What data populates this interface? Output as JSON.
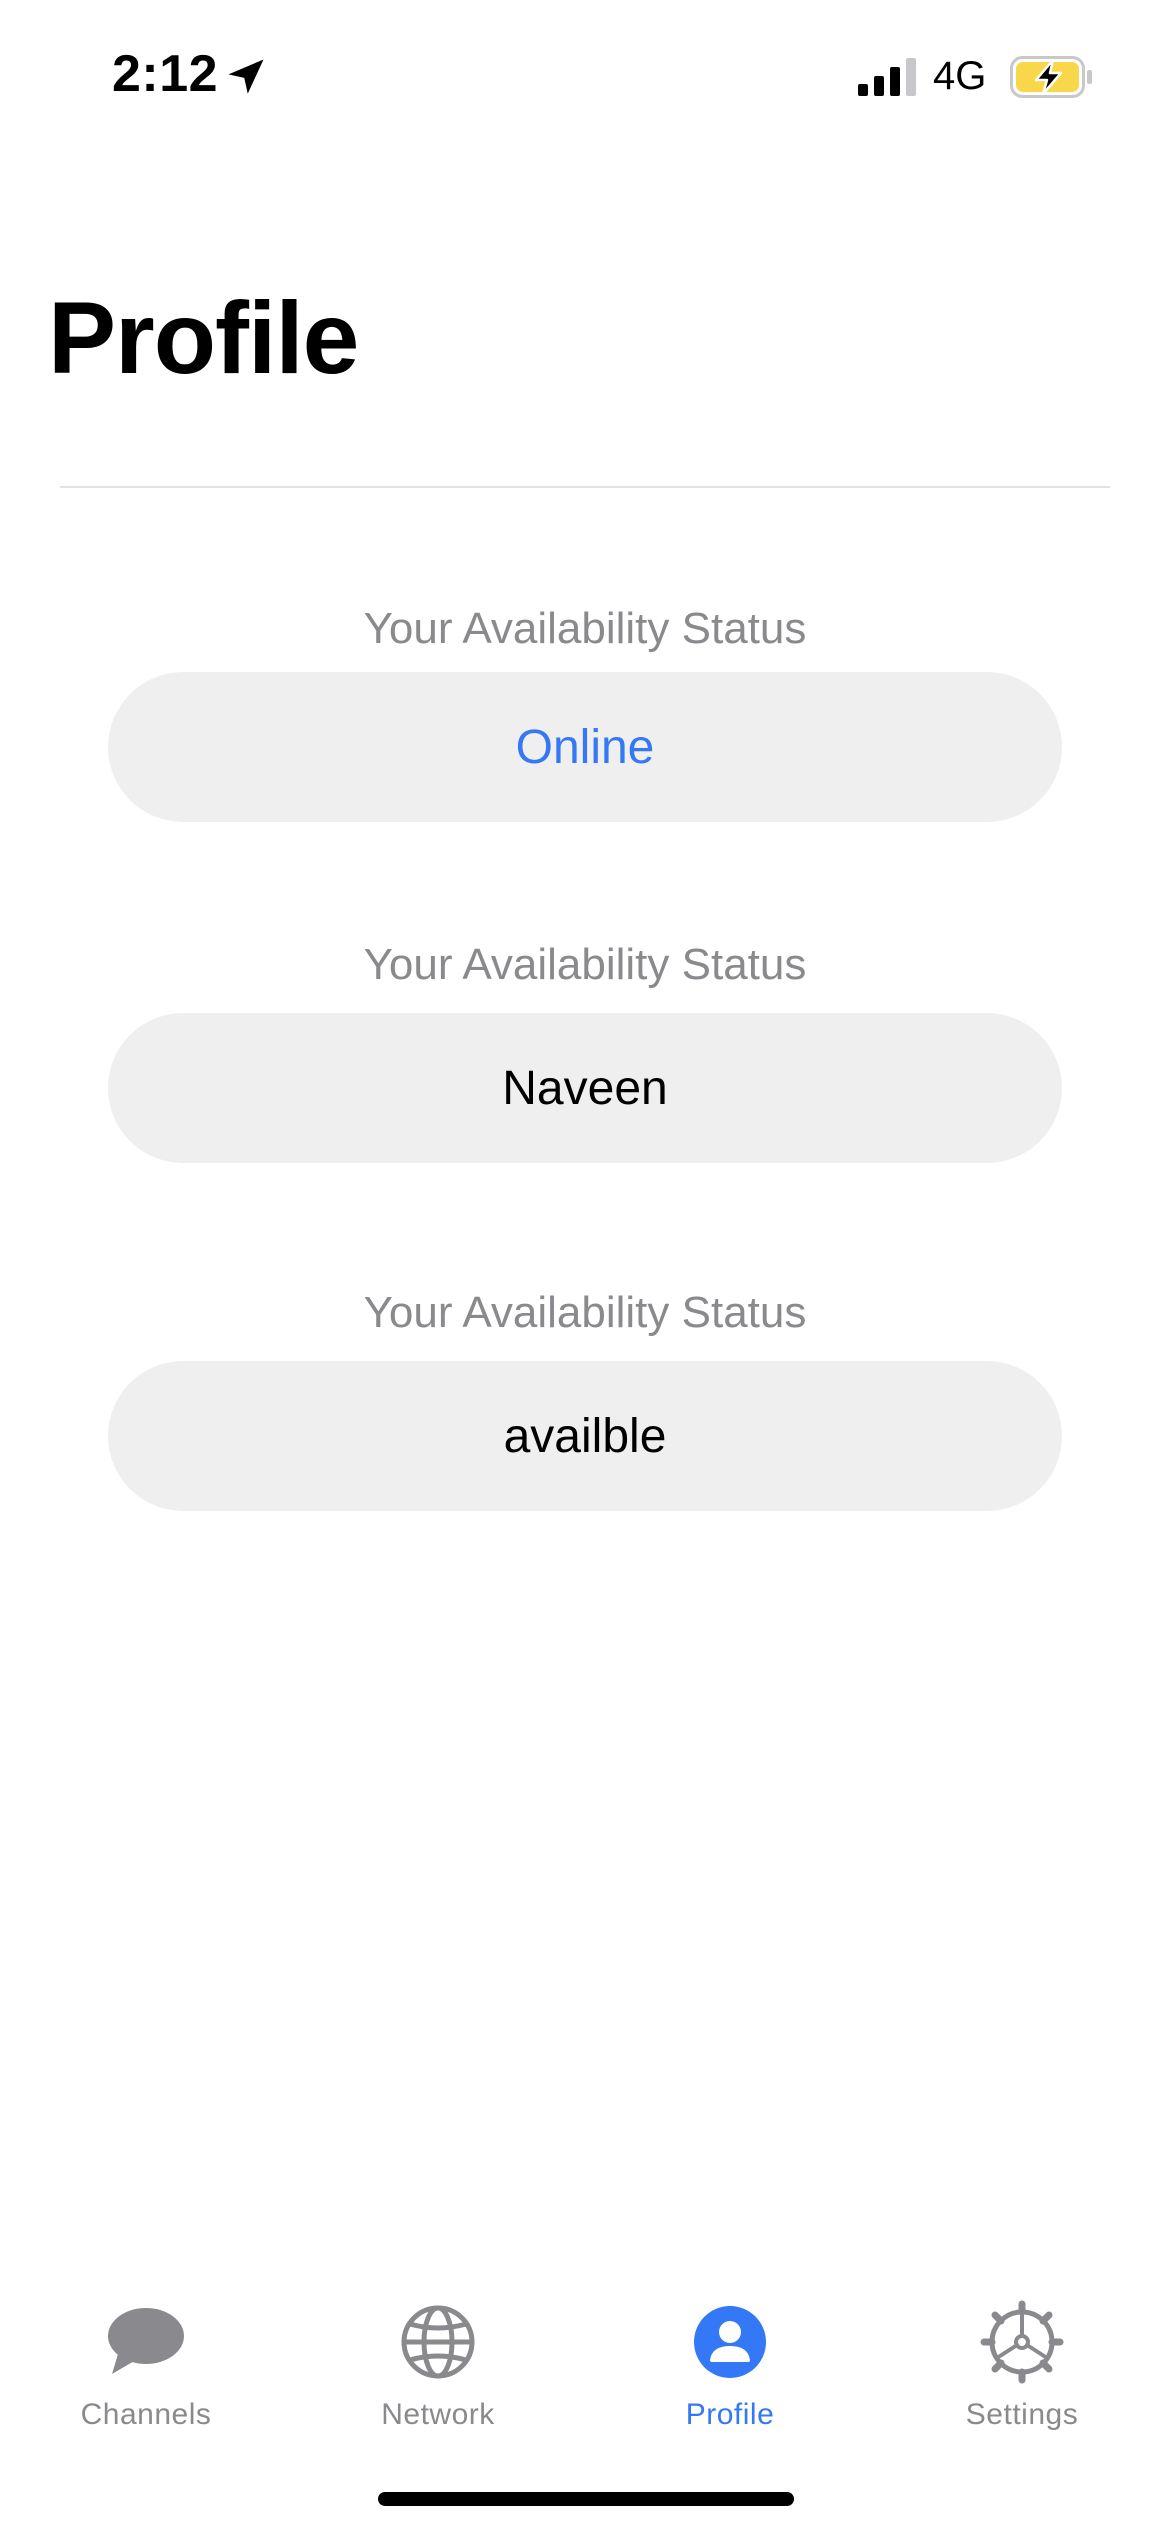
{
  "status_bar": {
    "time": "2:12",
    "network": "4G",
    "icons": [
      "location-arrow-icon",
      "cellular-signal-icon",
      "battery-charging-icon"
    ],
    "battery_color": "#f8d84a"
  },
  "header": {
    "title": "Profile"
  },
  "fields": [
    {
      "label": "Your Availability Status",
      "value": "Online"
    },
    {
      "label": "Your Availability Status",
      "value": "Naveen"
    },
    {
      "label": "Your Availability Status",
      "value": "availble"
    }
  ],
  "tab_bar": {
    "tabs": [
      {
        "label": "Channels",
        "icon": "chat-bubble-icon",
        "active": false
      },
      {
        "label": "Network",
        "icon": "globe-icon",
        "active": false
      },
      {
        "label": "Profile",
        "icon": "person-icon",
        "active": true
      },
      {
        "label": "Settings",
        "icon": "gear-icon",
        "active": false
      }
    ]
  },
  "colors": {
    "accent": "#3478f6",
    "inactive": "#8a8a8e",
    "pill_background": "#efefef"
  }
}
